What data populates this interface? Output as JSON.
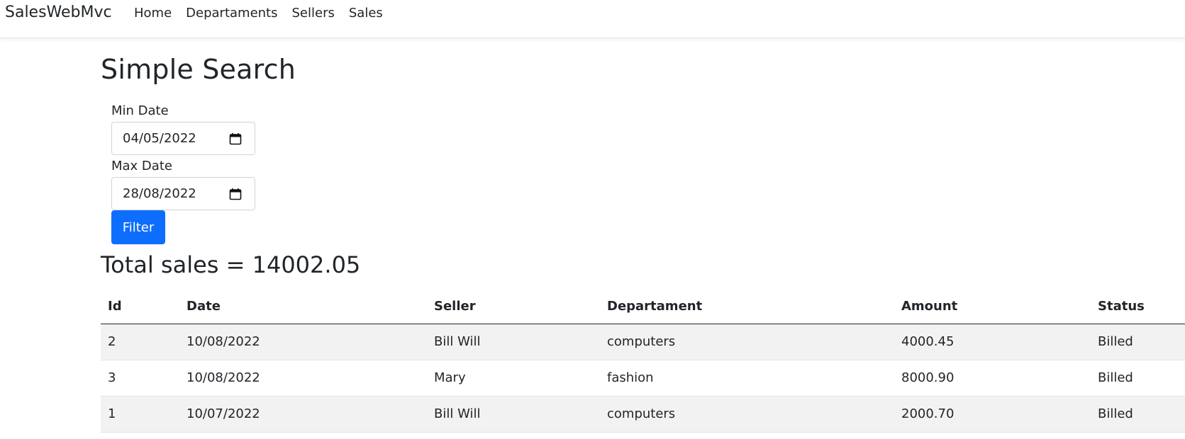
{
  "nav": {
    "brand": "SalesWebMvc",
    "links": [
      "Home",
      "Departaments",
      "Sellers",
      "Sales"
    ]
  },
  "page": {
    "title": "Simple Search"
  },
  "form": {
    "min_label": "Min Date",
    "min_value": "04/05/2022",
    "max_label": "Max Date",
    "max_value": "28/08/2022",
    "filter_label": "Filter"
  },
  "total": "Total sales = 14002.05",
  "table": {
    "headers": [
      "Id",
      "Date",
      "Seller",
      "Departament",
      "Amount",
      "Status"
    ],
    "rows": [
      [
        "2",
        "10/08/2022",
        "Bill Will",
        "computers",
        "4000.45",
        "Billed"
      ],
      [
        "3",
        "10/08/2022",
        "Mary",
        "fashion",
        "8000.90",
        "Billed"
      ],
      [
        "1",
        "10/07/2022",
        "Bill Will",
        "computers",
        "2000.70",
        "Billed"
      ]
    ]
  },
  "colors": {
    "primary": "#0d6efd",
    "text": "#212529",
    "stripe": "#f2f2f2"
  },
  "icons": {
    "date_picker": "calendar-icon"
  }
}
